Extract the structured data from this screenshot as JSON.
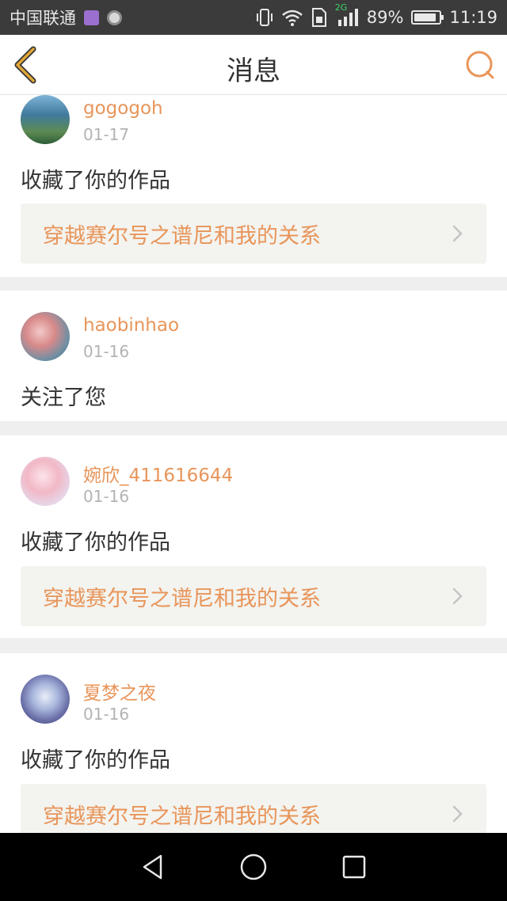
{
  "status_bar": {
    "carrier": "中国联通",
    "network": "2G",
    "battery": "89%",
    "battery_level": 0.89,
    "time": "11:19"
  },
  "header": {
    "title": "消息",
    "back_icon": "chevron-left-icon",
    "search_icon": "search-icon"
  },
  "messages": [
    {
      "user": "gogogoh",
      "date": "01-17",
      "action": "收藏了你的作品",
      "work": "穿越赛尔号之谱尼和我的关系"
    },
    {
      "user": "haobinhao",
      "date": "01-16",
      "action": "关注了您"
    },
    {
      "user": "婉欣_411616644",
      "date": "01-16",
      "action": "收藏了你的作品",
      "work": "穿越赛尔号之谱尼和我的关系"
    },
    {
      "user": "夏梦之夜",
      "date": "01-16",
      "action": "收藏了你的作品",
      "work": "穿越赛尔号之谱尼和我的关系"
    }
  ],
  "colors": {
    "accent": "#e8955a",
    "back_arrow": "#e0a63a",
    "card_box": "#f3f3ef"
  },
  "system_nav": [
    "back-triangle-icon",
    "home-circle-icon",
    "recents-square-icon"
  ]
}
